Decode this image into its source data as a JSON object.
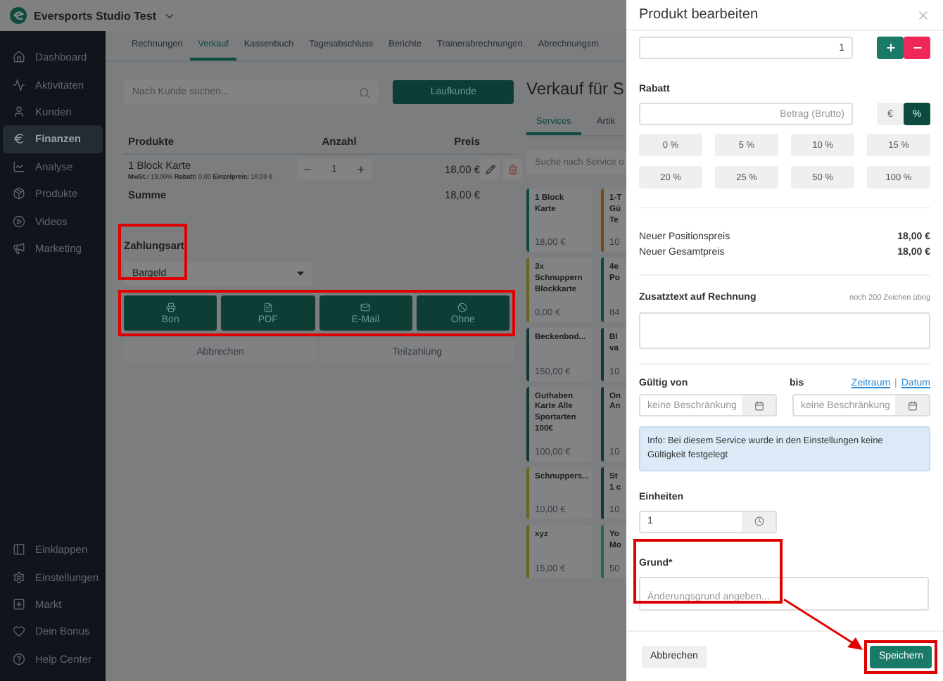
{
  "app": {
    "name": "Eversports Studio Test"
  },
  "sidebar": {
    "items": [
      {
        "label": "Dashboard",
        "selected": false
      },
      {
        "label": "Aktivitäten",
        "selected": false
      },
      {
        "label": "Kunden",
        "selected": false
      },
      {
        "label": "Finanzen",
        "selected": true
      },
      {
        "label": "Analyse",
        "selected": false
      },
      {
        "label": "Produkte",
        "selected": false
      },
      {
        "label": "Videos",
        "selected": false
      },
      {
        "label": "Marketing",
        "selected": false
      }
    ],
    "bottom_items": [
      {
        "label": "Einklappen"
      },
      {
        "label": "Einstellungen"
      },
      {
        "label": "Markt"
      },
      {
        "label": "Dein Bonus"
      },
      {
        "label": "Help Center"
      }
    ]
  },
  "tabs": [
    {
      "label": "Rechnungen",
      "selected": false
    },
    {
      "label": "Verkauf",
      "selected": true
    },
    {
      "label": "Kassenbuch",
      "selected": false
    },
    {
      "label": "Tagesabschluss",
      "selected": false
    },
    {
      "label": "Berichte",
      "selected": false
    },
    {
      "label": "Trainerabrechnungen",
      "selected": false
    },
    {
      "label": "Abrechnungsm",
      "selected": false
    }
  ],
  "sale": {
    "search": {
      "placeholder": "Nach Kunde suchen..."
    },
    "walk_in_button": "Laufkunde",
    "columns": [
      "Produkte",
      "Anzahl",
      "Preis"
    ],
    "rows": [
      {
        "name": "1 Block Karte",
        "details": "**MwSt.:** 19,00% **Rabatt:** 0,00 **Einzelpreis:** 18,00 €",
        "quantity": "1",
        "price": "18,00 €"
      }
    ],
    "total": {
      "label": "Summe",
      "value": "18,00 €"
    },
    "payment": {
      "label": "Zahlungsart",
      "value": "Bargeld",
      "highlighted": true
    },
    "receipt_buttons": {
      "highlighted": true,
      "items": [
        "Bon",
        "PDF",
        "E-Mail",
        "Ohne"
      ]
    },
    "cancel_button": "Abbrechen",
    "partial_button": "Teilzahlung"
  },
  "catalog": {
    "title": "Verkauf für S",
    "tabs": [
      {
        "label": "Services",
        "selected": true
      },
      {
        "label": "Artik",
        "selected": false
      }
    ],
    "search": {
      "placeholder": "Suche nach Service o"
    },
    "cards": [
      {
        "lines": [
          "1 Block Karte"
        ],
        "price": "18,00 €",
        "color": "#0f4a3f"
      },
      {
        "lines": [
          "1-T",
          "Gü",
          "Te"
        ],
        "price": "10",
        "color": "#7a4a10"
      },
      {
        "lines": [
          "3x",
          "Schnuppern",
          "Blockkarte"
        ],
        "price": "0,00 €",
        "color": "#6b6420"
      },
      {
        "lines": [
          "4e",
          "Po"
        ],
        "price": "84",
        "color": "#0f4a3f"
      },
      {
        "lines": [
          "Beckenbod..."
        ],
        "price": "150,00 €",
        "color": "#0f3a34"
      },
      {
        "lines": [
          "Bl",
          "va"
        ],
        "price": "10",
        "color": "#0f3a34"
      },
      {
        "lines": [
          "Guthaben",
          "Karte Alle",
          "Sportarten",
          "100€"
        ],
        "price": "100,00 €",
        "color": "#0f3a34"
      },
      {
        "lines": [
          "On",
          "An"
        ],
        "price": "10",
        "color": "#0f3a34"
      },
      {
        "lines": [
          "Schnuppers..."
        ],
        "price": "10,00 €",
        "color": "#6b6420"
      },
      {
        "lines": [
          "St",
          "1 c"
        ],
        "price": "10",
        "color": "#0f3a34"
      },
      {
        "lines": [
          "xyz"
        ],
        "price": "15,00 €",
        "color": "#6b6420"
      },
      {
        "lines": [
          "Yo",
          "Mo"
        ],
        "price": "50",
        "color": "#1d6b55"
      }
    ]
  },
  "drawer": {
    "title": "Produkt bearbeiten",
    "quantity": "1",
    "discount": {
      "label": "Rabatt",
      "placeholder": "Betrag (Brutto)",
      "units": [
        {
          "label": "€",
          "selected": false
        },
        {
          "label": "%",
          "selected": true
        }
      ],
      "presets": [
        "0 %",
        "5 %",
        "10 %",
        "15 %",
        "20 %",
        "25 %",
        "50 %",
        "100 %"
      ]
    },
    "prices": [
      {
        "label": "Neuer Positionspreis",
        "value": "18,00 €"
      },
      {
        "label": "Neuer Gesamtpreis",
        "value": "18,00 €"
      }
    ],
    "note": {
      "label": "Zusatztext auf Rechnung",
      "counter": "noch 200 Zeichen übrig"
    },
    "validity": {
      "from_label": "Gültig von",
      "to_label": "bis",
      "links": [
        "Zeitraum",
        "Datum"
      ],
      "separator": "|",
      "from_placeholder": "keine Beschränkung",
      "to_placeholder": "keine Beschränkung",
      "info": "Info: Bei diesem Service wurde in den Einstellungen keine Gültigkeit festgelegt"
    },
    "units": {
      "label": "Einheiten",
      "value": "1"
    },
    "reason": {
      "label": "Grund*",
      "placeholder": "Änderungsgrund angeben...",
      "highlighted": true
    },
    "cancel_button": "Abbrechen",
    "save_button": {
      "label": "Speichern",
      "highlighted": true
    }
  }
}
